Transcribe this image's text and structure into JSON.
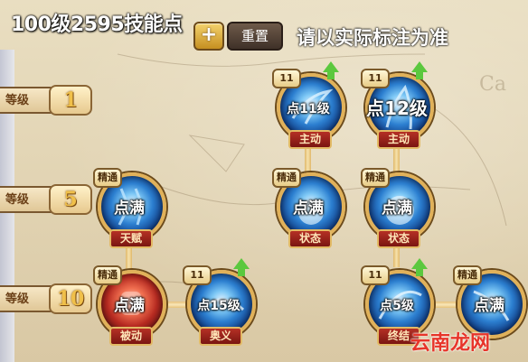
{
  "header": {
    "title": "100级2595技能点",
    "reset_label": "重置",
    "plus_label": "+",
    "note": "请以实际标注为准"
  },
  "levels": [
    {
      "label": "等级",
      "number": "1"
    },
    {
      "label": "等级",
      "number": "5"
    },
    {
      "label": "等级",
      "number": "10"
    }
  ],
  "skills": [
    {
      "badge": "11",
      "overlay": "点11级",
      "type": "主动",
      "has_upgrade_arrow": true
    },
    {
      "badge": "11",
      "overlay": "点12级",
      "type": "主动",
      "has_upgrade_arrow": true
    },
    {
      "badge": "精通",
      "overlay": "点满",
      "type": "天赋",
      "has_upgrade_arrow": false
    },
    {
      "badge": "精通",
      "overlay": "点满",
      "type": "状态",
      "has_upgrade_arrow": false
    },
    {
      "badge": "精通",
      "overlay": "点满",
      "type": "状态",
      "has_upgrade_arrow": false
    },
    {
      "badge": "精通",
      "overlay": "点满",
      "type": "被动",
      "has_upgrade_arrow": false
    },
    {
      "badge": "11",
      "overlay": "点15级",
      "type": "奥义",
      "has_upgrade_arrow": true
    },
    {
      "badge": "11",
      "overlay": "点5级",
      "type": "终结",
      "has_upgrade_arrow": true
    },
    {
      "badge": "精通",
      "overlay": "点满",
      "type": "",
      "has_upgrade_arrow": false
    }
  ],
  "watermark": "云南龙网",
  "colors": {
    "accent_gold": "#e0b15a",
    "plate_red": "#b53025",
    "upgrade_green": "#5bc83e",
    "watermark_red": "#e7352a"
  },
  "icons": [
    "plus-icon",
    "upgrade-arrow-icon",
    "skill-icon"
  ]
}
